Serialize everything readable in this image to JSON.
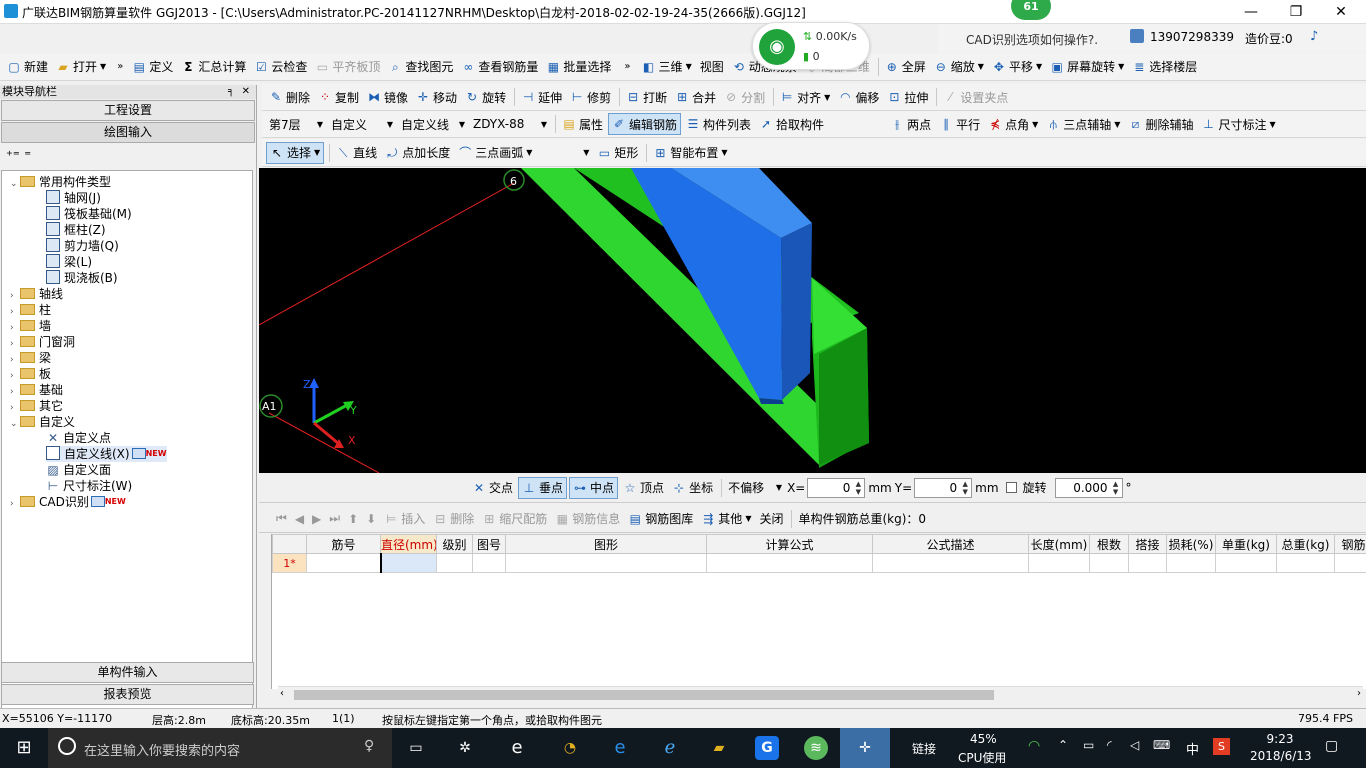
{
  "window": {
    "title": "广联达BIM钢筋算量软件 GGJ2013 - [C:\\Users\\Administrator.PC-20141127NRHM\\Desktop\\白龙村-2018-02-02-19-24-35(2666版).GGJ12]",
    "badge": "61"
  },
  "network": {
    "speed": "0.00K/s",
    "count": "0"
  },
  "header": {
    "cad_tip": "CAD识别选项如何操作?.",
    "phone": "13907298339",
    "beans": "造价豆:0"
  },
  "toolbar1": {
    "new": "新建",
    "open": "打开",
    "define": "定义",
    "summary": "汇总计算",
    "cloud_check": "云检查",
    "align_slab": "平齐板顶",
    "find": "查找图元",
    "view_rebar": "查看钢筋量",
    "batch_select": "批量选择",
    "three_d": "三维",
    "view": "视图",
    "dyn_view": "动态观察",
    "local_3d": "局部三维",
    "fullscreen": "全屏",
    "zoom": "缩放",
    "pan": "平移",
    "rotate": "屏幕旋转",
    "select_floor": "选择楼层"
  },
  "toolbar2": {
    "delete": "删除",
    "copy": "复制",
    "mirror": "镜像",
    "move": "移动",
    "rotate": "旋转",
    "extend": "延伸",
    "trim": "修剪",
    "break": "打断",
    "merge": "合并",
    "split": "分割",
    "align": "对齐",
    "offset": "偏移",
    "stretch": "拉伸",
    "set_grip": "设置夹点"
  },
  "toolbar3": {
    "floor": "第7层",
    "category": "自定义",
    "subcategory": "自定义线",
    "component": "ZDYX-88",
    "props": "属性",
    "edit_rebar": "编辑钢筋",
    "component_list": "构件列表",
    "pick": "拾取构件",
    "two_points": "两点",
    "parallel": "平行",
    "point_angle": "点角",
    "three_point_axis": "三点辅轴",
    "delete_axis": "删除辅轴",
    "dimension": "尺寸标注"
  },
  "toolbar4": {
    "select": "选择",
    "line": "直线",
    "point_length": "点加长度",
    "arc": "三点画弧",
    "rect": "矩形",
    "smart": "智能布置"
  },
  "sidebar": {
    "title": "模块导航栏",
    "pin": "ᵖ",
    "project_settings": "工程设置",
    "drawing_input": "绘图输入",
    "single_input": "单构件输入",
    "report": "报表预览",
    "tree": {
      "common": "常用构件类型",
      "common_items": [
        "轴网(J)",
        "筏板基础(M)",
        "框柱(Z)",
        "剪力墙(Q)",
        "梁(L)",
        "现浇板(B)"
      ],
      "groups": [
        "轴线",
        "柱",
        "墙",
        "门窗洞",
        "梁",
        "板",
        "基础",
        "其它"
      ],
      "custom": "自定义",
      "custom_items": [
        "自定义点",
        "自定义线(X)",
        "自定义面",
        "尺寸标注(W)"
      ],
      "cad": "CAD识别",
      "new_tag": "NEW"
    }
  },
  "viewport": {
    "axis_top": "6",
    "axis_left": "A1",
    "ax_z": "Z",
    "ax_y": "Y",
    "ax_x": "X"
  },
  "snap": {
    "intersect": "交点",
    "perpendicular": "垂点",
    "midpoint": "中点",
    "vertex": "顶点",
    "coord": "坐标",
    "offset_mode": "不偏移",
    "x_label": "X=",
    "x_val": "0",
    "mm1": "mm",
    "y_label": "Y=",
    "y_val": "0",
    "mm2": "mm",
    "rotate": "旋转",
    "angle": "0.000",
    "deg": "°"
  },
  "grid_toolbar": {
    "insert": "插入",
    "delete": "删除",
    "scale": "缩尺配筋",
    "info": "钢筋信息",
    "library": "钢筋图库",
    "other": "其他",
    "close": "关闭",
    "total": "单构件钢筋总重(kg)：0"
  },
  "grid": {
    "headers": [
      "筋号",
      "直径(mm)",
      "级别",
      "图号",
      "图形",
      "计算公式",
      "公式描述",
      "长度(mm)",
      "根数",
      "搭接",
      "损耗(%)",
      "单重(kg)",
      "总重(kg)",
      "钢筋"
    ],
    "row1": "1*"
  },
  "status": {
    "coords": "X=55106 Y=-11170",
    "floor_height": "层高:2.8m",
    "bottom_height": "底标高:20.35m",
    "count": "1(1)",
    "hint": "按鼠标左键指定第一个角点，或拾取构件图元",
    "fps": "795.4 FPS"
  },
  "taskbar": {
    "search": "在这里输入你要搜索的内容",
    "link": "链接",
    "cpu_pct": "45%",
    "cpu_label": "CPU使用",
    "ime": "中",
    "time": "9:23",
    "date": "2018/6/13"
  }
}
